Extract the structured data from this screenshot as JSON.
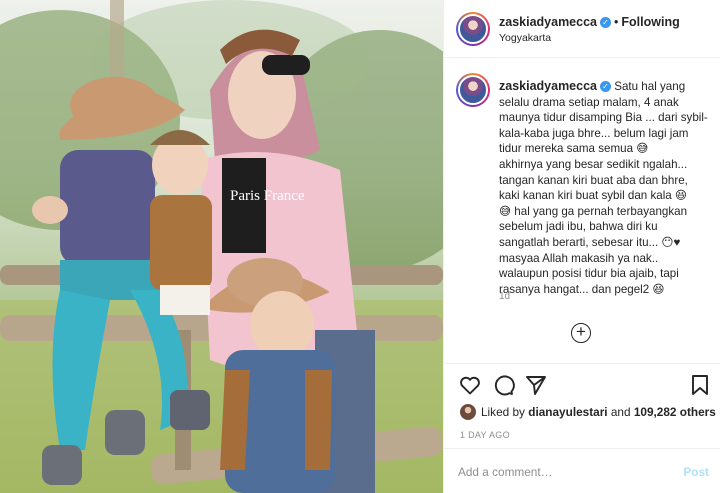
{
  "post": {
    "photo": {
      "alt": "Mother with four children wearing cowboy hats sitting on a wooden fence",
      "print_text": "Paris France"
    },
    "header": {
      "username": "zaskiadyamecca",
      "separator": "•",
      "follow_state": "Following",
      "location": "Yogyakarta"
    },
    "caption": {
      "username": "zaskiadyamecca",
      "text": "Satu hal yang selalu drama setiap malam, 4 anak maunya tidur disamping Bia ... dari sybil-kala-kaba juga bhre... belum lagi jam tidur mereka sama semua 😅\nakhirnya yang besar sedikit ngalah... tangan kanan kiri buat aba dan bhre, kaki kanan kiri buat sybil dan kala 😆\n😅 hal yang ga pernah terbayangkan sebelum jadi ibu, bahwa diri ku sangatlah berarti, sebesar itu... 😶♥\nmasyaa Allah makasih ya nak.. walaupun posisi tidur bia ajaib, tapi rasanya hangat... dan pegel2 😆",
      "time": "1d"
    },
    "likes": {
      "prefix": "Liked by",
      "liker": "dianayulestari",
      "conjunction": "and",
      "others": "109,282 others"
    },
    "posted_ago": "1 DAY AGO",
    "comment": {
      "placeholder": "Add a comment…",
      "post_label": "Post"
    },
    "icons": {
      "verified": "verified-badge-icon",
      "load_more": "plus-circle-icon",
      "like": "heart-icon",
      "comment": "comment-bubble-icon",
      "share": "paper-plane-icon",
      "save": "bookmark-icon"
    },
    "colors": {
      "verified_blue": "#3897f0",
      "post_button_disabled": "#b2dffc",
      "muted_text": "#8e8e8e",
      "border": "#efefef"
    }
  }
}
